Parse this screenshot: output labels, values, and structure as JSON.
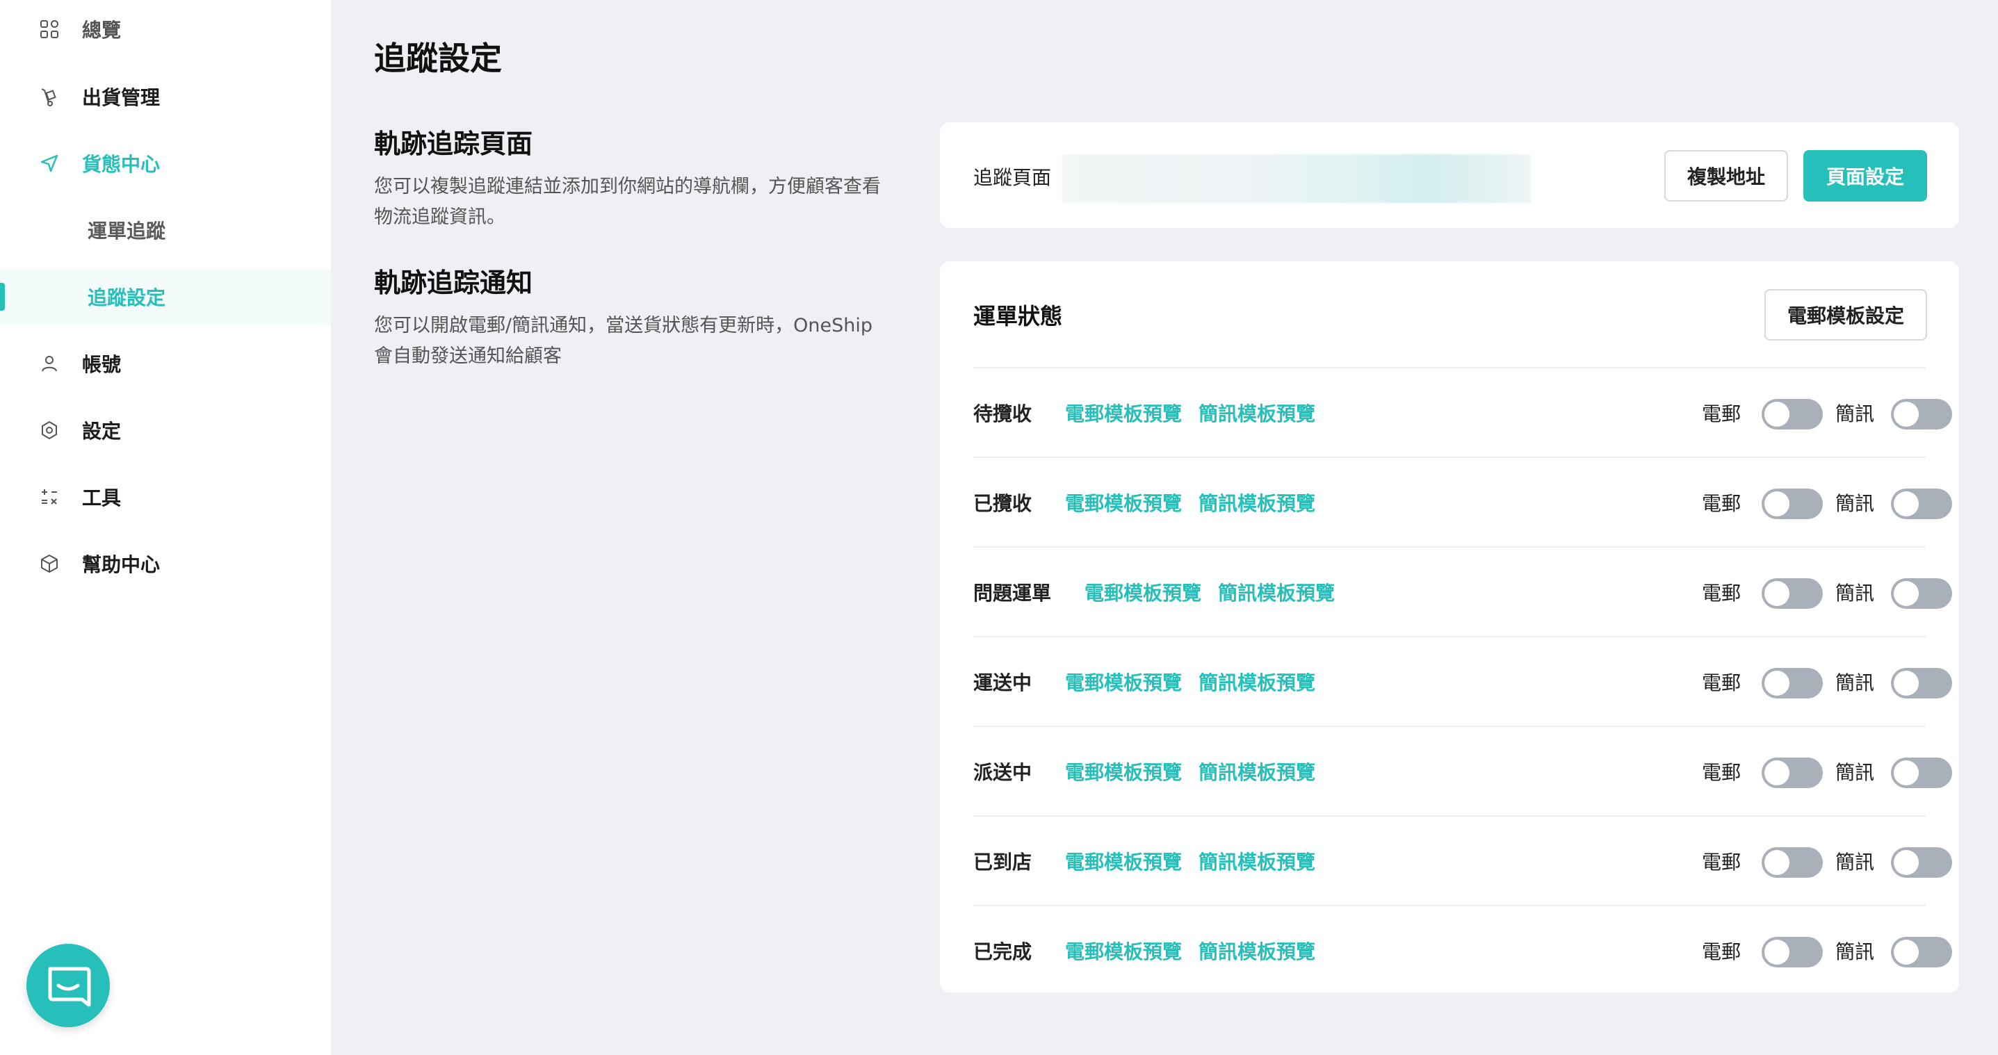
{
  "sidebar": {
    "items": [
      {
        "label": "總覽",
        "icon": "grid-icon"
      },
      {
        "label": "出貨管理",
        "icon": "dolly-icon"
      },
      {
        "label": "貨態中心",
        "icon": "navigation-arrow-icon"
      },
      {
        "label": "運單追蹤"
      },
      {
        "label": "追蹤設定"
      },
      {
        "label": "帳號",
        "icon": "user-icon"
      },
      {
        "label": "設定",
        "icon": "hexagon-settings-icon"
      },
      {
        "label": "工具",
        "icon": "calculator-icon"
      },
      {
        "label": "幫助中心",
        "icon": "box-icon"
      }
    ],
    "accent_color": "#26bfb9"
  },
  "page": {
    "title": "追蹤設定",
    "tracking_section": {
      "title": "軌跡追踪頁面",
      "desc_line1": "您可以複製追蹤連結並添加到你網站的導航欄，方便顧客查看",
      "desc_line2": "物流追蹤資訊。"
    },
    "notify_section": {
      "title": "軌跡追踪通知",
      "desc_line1": "您可以開啟電郵/簡訊通知，當送貨狀態有更新時，OneShip",
      "desc_line2": "會自動發送通知給顧客"
    }
  },
  "tracking_card": {
    "label": "追蹤頁面",
    "copy_button": "複製地址",
    "settings_button": "頁面設定"
  },
  "status_card": {
    "title": "運單狀態",
    "template_button": "電郵模板設定",
    "email_label": "電郵",
    "sms_label": "簡訊",
    "email_preview": "電郵模板預覽",
    "sms_preview": "簡訊模板預覽",
    "rows": [
      {
        "name": "待攬收",
        "email_on": false,
        "sms_on": false
      },
      {
        "name": "已攬收",
        "email_on": false,
        "sms_on": false
      },
      {
        "name": "問題運單",
        "email_on": false,
        "sms_on": false
      },
      {
        "name": "運送中",
        "email_on": false,
        "sms_on": false
      },
      {
        "name": "派送中",
        "email_on": false,
        "sms_on": false
      },
      {
        "name": "已到店",
        "email_on": false,
        "sms_on": false
      },
      {
        "name": "已完成",
        "email_on": false,
        "sms_on": false
      }
    ]
  },
  "chat": {
    "icon": "chat-icon"
  }
}
